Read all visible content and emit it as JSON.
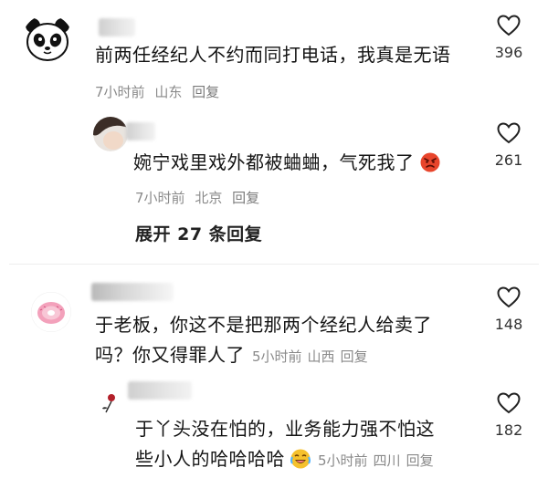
{
  "comments": [
    {
      "text": "前两任经纪人不约而同打电话，我真是无语",
      "time": "7小时前",
      "location": "山东",
      "reply_label": "回复",
      "likes": "396",
      "replies": [
        {
          "text": "婉宁戏里戏外都被蛐蛐，气死我了",
          "emoji": "angry-face",
          "time": "7小时前",
          "location": "北京",
          "reply_label": "回复",
          "likes": "261"
        }
      ],
      "expand_label": "展开 27 条回复"
    },
    {
      "text_line1": "于老板，你这不是把那两个经纪人给卖了",
      "text_line2": "吗？你又得罪人了",
      "time": "5小时前",
      "location": "山西",
      "reply_label": "回复",
      "likes": "148",
      "replies": [
        {
          "text_line1": "于丫头没在怕的，业务能力强不怕这",
          "text_line2": "些小人的哈哈哈哈",
          "emoji": "laughing-crying-face",
          "time": "5小时前",
          "location": "四川",
          "reply_label": "回复",
          "likes": "182"
        }
      ]
    }
  ],
  "colors": {
    "text": "#141414",
    "meta": "#8a8a8a",
    "heart_stroke": "#222222",
    "angry_emoji": "#e8452c",
    "laugh_emoji": "#f5c12e"
  }
}
